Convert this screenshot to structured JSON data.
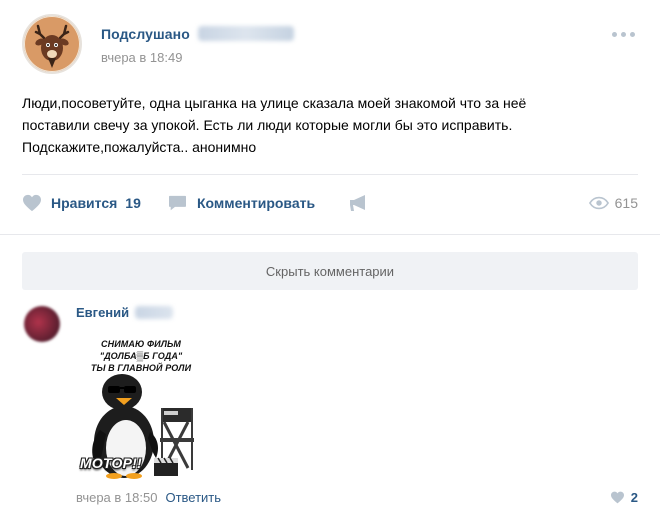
{
  "post": {
    "author": "Подслушано",
    "time": "вчера в 18:49",
    "text_lines": [
      "Люди,посоветуйте, одна цыганка на улице сказала моей знакомой что за неё",
      "поставили свечу за упокой. Есть ли люди которые могли бы это исправить.",
      "Подскажите,пожалуйста.. анонимно"
    ],
    "avatar_icon": "deer-icon"
  },
  "actions": {
    "like_label": "Нравится",
    "like_count": "19",
    "comment_label": "Комментировать",
    "views_count": "615"
  },
  "comments": {
    "hide_label": "Скрыть комментарии",
    "items": [
      {
        "author": "Евгений",
        "meme": {
          "line1": "СНИМАЮ ФИЛЬМ",
          "line2": "\"ДОЛБА▒Б ГОДА\"",
          "line3": "ТЫ В ГЛАВНОЙ РОЛИ",
          "caption": "МОТОР!!"
        },
        "time": "вчера в 18:50",
        "reply_label": "Ответить",
        "like_count": "2"
      }
    ]
  },
  "colors": {
    "link": "#2a5885",
    "muted": "#939393",
    "icon": "#b9c4cf",
    "divider": "#e7e8ec",
    "button_bg": "#f0f2f5"
  }
}
